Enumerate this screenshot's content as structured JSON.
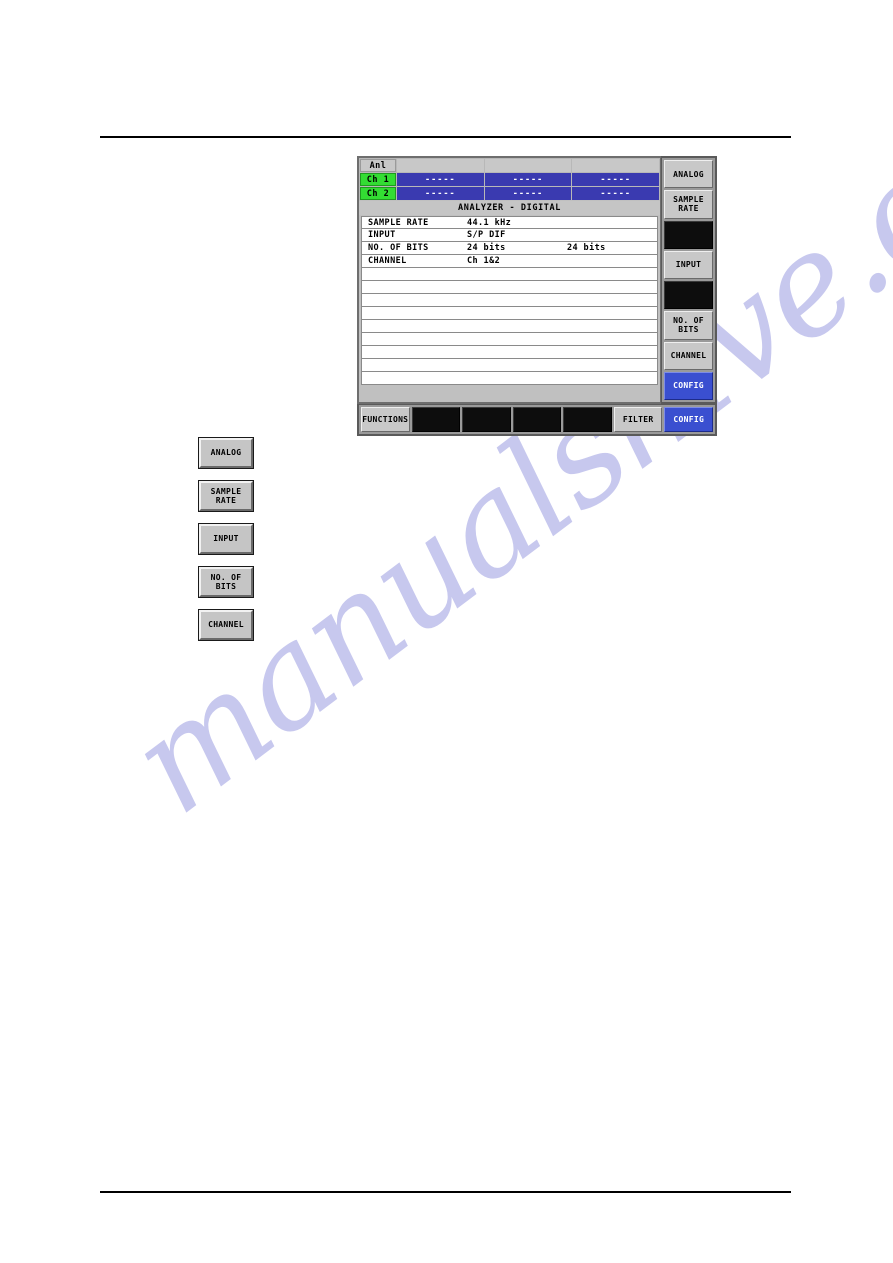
{
  "page": {
    "background_color": "#ffffff",
    "rule_color": "#000000"
  },
  "watermark": {
    "text": "manualshive.com",
    "color": "#c7c8ee"
  },
  "screen": {
    "measurement_header": {
      "instrument_label": "Anl",
      "column_headers": [
        "",
        "",
        ""
      ]
    },
    "measurement_rows": [
      {
        "label": "Ch 1",
        "values": [
          "-----",
          "-----",
          "-----"
        ]
      },
      {
        "label": "Ch 2",
        "values": [
          "-----",
          "-----",
          "-----"
        ]
      }
    ],
    "title": "ANALYZER  -  DIGITAL",
    "settings": [
      {
        "key": "SAMPLE RATE",
        "value1": "44.1 kHz",
        "value2": ""
      },
      {
        "key": "INPUT",
        "value1": "S/P DIF",
        "value2": ""
      },
      {
        "key": "NO. OF BITS",
        "value1": "24 bits",
        "value2": "24 bits"
      },
      {
        "key": "CHANNEL",
        "value1": "Ch 1&2",
        "value2": ""
      },
      {
        "key": "",
        "value1": "",
        "value2": ""
      },
      {
        "key": "",
        "value1": "",
        "value2": ""
      },
      {
        "key": "",
        "value1": "",
        "value2": ""
      },
      {
        "key": "",
        "value1": "",
        "value2": ""
      },
      {
        "key": "",
        "value1": "",
        "value2": ""
      },
      {
        "key": "",
        "value1": "",
        "value2": ""
      },
      {
        "key": "",
        "value1": "",
        "value2": ""
      },
      {
        "key": "",
        "value1": "",
        "value2": ""
      },
      {
        "key": "",
        "value1": "",
        "value2": ""
      }
    ],
    "softkeys": [
      {
        "label": "ANALOG",
        "state": "normal"
      },
      {
        "label": "SAMPLE\nRATE",
        "state": "normal"
      },
      {
        "label": "",
        "state": "blank"
      },
      {
        "label": "INPUT",
        "state": "normal"
      },
      {
        "label": "",
        "state": "blank"
      },
      {
        "label": "NO. OF\nBITS",
        "state": "normal"
      },
      {
        "label": "CHANNEL",
        "state": "normal"
      },
      {
        "label": "CONFIG",
        "state": "active"
      }
    ],
    "function_keys": [
      {
        "label": "FUNCTIONS",
        "state": "normal"
      },
      {
        "label": "",
        "state": "blank"
      },
      {
        "label": "",
        "state": "blank"
      },
      {
        "label": "",
        "state": "blank"
      },
      {
        "label": "",
        "state": "blank"
      },
      {
        "label": "FILTER",
        "state": "normal"
      },
      {
        "label": "CONFIG",
        "state": "active"
      }
    ],
    "colors": {
      "channel_green": "#33dd33",
      "value_blue": "#3a3ab0",
      "active_blue": "#3a4fd0",
      "panel_gray": "#c0c0c0"
    }
  },
  "standalone_keys": [
    {
      "label": "ANALOG"
    },
    {
      "label": "SAMPLE\nRATE"
    },
    {
      "label": "INPUT"
    },
    {
      "label": "NO. OF\nBITS"
    },
    {
      "label": "CHANNEL"
    }
  ]
}
